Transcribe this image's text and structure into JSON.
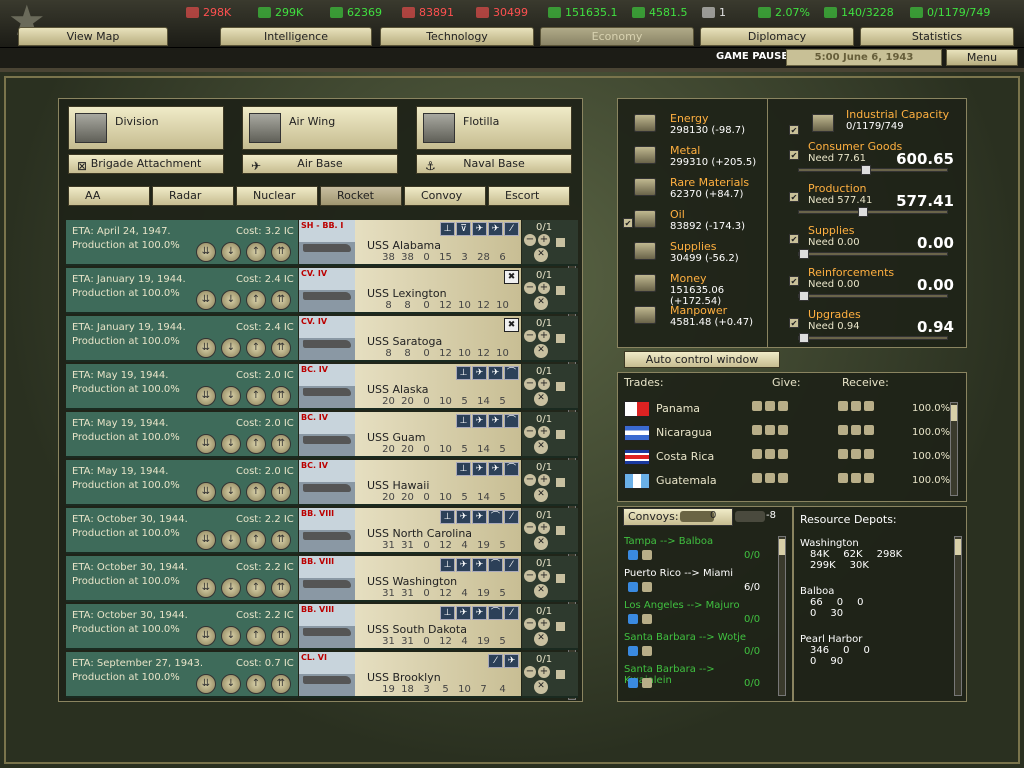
{
  "topbar": {
    "resources": [
      {
        "icon": "energy-icon",
        "value": "298K",
        "color": "#ff5050"
      },
      {
        "icon": "metal-icon",
        "value": "299K",
        "color": "#40e040"
      },
      {
        "icon": "rare-materials-icon",
        "value": "62369",
        "color": "#40e040"
      },
      {
        "icon": "oil-icon",
        "value": "83891",
        "color": "#ff5050"
      },
      {
        "icon": "supplies-icon",
        "value": "30499",
        "color": "#ff5050"
      },
      {
        "icon": "money-icon",
        "value": "151635.1",
        "color": "#40e040"
      },
      {
        "icon": "manpower-icon",
        "value": "4581.5",
        "color": "#40e040"
      },
      {
        "icon": "nuclear-icon",
        "value": "1",
        "color": "#e0e0e0"
      },
      {
        "icon": "dissent-icon",
        "value": "2.07%",
        "color": "#40e040"
      },
      {
        "icon": "transport-icon",
        "value": "140/3228",
        "color": "#40e040"
      },
      {
        "icon": "ic-icon",
        "value": "0/1179/749",
        "color": "#40e040"
      }
    ],
    "tabs": [
      "View Map",
      "Intelligence",
      "Technology",
      "Economy",
      "Diplomacy",
      "Statistics"
    ],
    "status": "GAME PAUSED",
    "date": "5:00 June 6, 1943",
    "menu": "Menu"
  },
  "build": {
    "types": [
      {
        "label": "Division",
        "icon": "division-icon"
      },
      {
        "label": "Air Wing",
        "icon": "air-wing-icon"
      },
      {
        "label": "Flotilla",
        "icon": "flotilla-icon"
      }
    ],
    "attachments": [
      {
        "label": "Brigade Attachment",
        "icon": "brigade-icon",
        "sym": "⊠"
      },
      {
        "label": "Air Base",
        "icon": "air-base-icon",
        "sym": "✈"
      },
      {
        "label": "Naval Base",
        "icon": "naval-base-icon",
        "sym": "⚓"
      }
    ],
    "filters": [
      {
        "label": "AA",
        "on": false
      },
      {
        "label": "Radar",
        "on": false
      },
      {
        "label": "Nuclear",
        "on": false
      },
      {
        "label": "Rocket",
        "on": true
      },
      {
        "label": "Convoy",
        "on": false
      },
      {
        "label": "Escort",
        "on": false
      }
    ]
  },
  "queue": [
    {
      "eta": "ETA: April 24, 1947.",
      "prod": "Production at 100.0%",
      "cost": "Cost: 3.2 IC",
      "cls": "SH - BB. I",
      "name": "USS Alabama",
      "stats": [
        "38",
        "38",
        "0",
        "15",
        "3",
        "28",
        "6"
      ],
      "roles": [
        "⊥",
        "⊽",
        "✈",
        "✈",
        "⁄"
      ],
      "frac": "0/1"
    },
    {
      "eta": "ETA: January 19, 1944.",
      "prod": "Production at 100.0%",
      "cost": "Cost: 2.4 IC",
      "cls": "CV. IV",
      "name": "USS Lexington",
      "stats": [
        "8",
        "8",
        "0",
        "12",
        "10",
        "12",
        "10"
      ],
      "roles": [
        "x"
      ],
      "frac": "0/1"
    },
    {
      "eta": "ETA: January 19, 1944.",
      "prod": "Production at 100.0%",
      "cost": "Cost: 2.4 IC",
      "cls": "CV. IV",
      "name": "USS Saratoga",
      "stats": [
        "8",
        "8",
        "0",
        "12",
        "10",
        "12",
        "10"
      ],
      "roles": [
        "x"
      ],
      "frac": "0/1"
    },
    {
      "eta": "ETA: May 19, 1944.",
      "prod": "Production at 100.0%",
      "cost": "Cost: 2.0 IC",
      "cls": "BC. IV",
      "name": "USS Alaska",
      "stats": [
        "20",
        "20",
        "0",
        "10",
        "5",
        "14",
        "5"
      ],
      "roles": [
        "⊥",
        "✈",
        "✈",
        "⌒"
      ],
      "frac": "0/1"
    },
    {
      "eta": "ETA: May 19, 1944.",
      "prod": "Production at 100.0%",
      "cost": "Cost: 2.0 IC",
      "cls": "BC. IV",
      "name": "USS Guam",
      "stats": [
        "20",
        "20",
        "0",
        "10",
        "5",
        "14",
        "5"
      ],
      "roles": [
        "⊥",
        "✈",
        "✈",
        "⌒"
      ],
      "frac": "0/1"
    },
    {
      "eta": "ETA: May 19, 1944.",
      "prod": "Production at 100.0%",
      "cost": "Cost: 2.0 IC",
      "cls": "BC. IV",
      "name": "USS Hawaii",
      "stats": [
        "20",
        "20",
        "0",
        "10",
        "5",
        "14",
        "5"
      ],
      "roles": [
        "⊥",
        "✈",
        "✈",
        "⌒"
      ],
      "frac": "0/1"
    },
    {
      "eta": "ETA: October 30, 1944.",
      "prod": "Production at 100.0%",
      "cost": "Cost: 2.2 IC",
      "cls": "BB. VIII",
      "name": "USS North Carolina",
      "stats": [
        "31",
        "31",
        "0",
        "12",
        "4",
        "19",
        "5"
      ],
      "roles": [
        "⊥",
        "✈",
        "✈",
        "⌒",
        "⁄"
      ],
      "frac": "0/1"
    },
    {
      "eta": "ETA: October 30, 1944.",
      "prod": "Production at 100.0%",
      "cost": "Cost: 2.2 IC",
      "cls": "BB. VIII",
      "name": "USS Washington",
      "stats": [
        "31",
        "31",
        "0",
        "12",
        "4",
        "19",
        "5"
      ],
      "roles": [
        "⊥",
        "✈",
        "✈",
        "⌒",
        "⁄"
      ],
      "frac": "0/1"
    },
    {
      "eta": "ETA: October 30, 1944.",
      "prod": "Production at 100.0%",
      "cost": "Cost: 2.2 IC",
      "cls": "BB. VIII",
      "name": "USS South Dakota",
      "stats": [
        "31",
        "31",
        "0",
        "12",
        "4",
        "19",
        "5"
      ],
      "roles": [
        "⊥",
        "✈",
        "✈",
        "⌒",
        "⁄"
      ],
      "frac": "0/1"
    },
    {
      "eta": "ETA: September 27, 1943.",
      "prod": "Production at 100.0%",
      "cost": "Cost: 0.7 IC",
      "cls": "CL. VI",
      "name": "USS Brooklyn",
      "stats": [
        "19",
        "18",
        "3",
        "5",
        "10",
        "7",
        "4"
      ],
      "roles": [
        "⁄",
        "✈"
      ],
      "frac": "0/1"
    }
  ],
  "resources": [
    {
      "name": "Energy",
      "value": "298130 (-98.7)",
      "icon": "energy-icon"
    },
    {
      "name": "Metal",
      "value": "299310 (+205.5)",
      "icon": "metal-icon"
    },
    {
      "name": "Rare Materials",
      "value": "62370 (+84.7)",
      "icon": "rare-materials-icon"
    },
    {
      "name": "Oil",
      "value": "83892 (-174.3)",
      "icon": "oil-icon"
    },
    {
      "name": "Supplies",
      "value": "30499 (-56.2)",
      "icon": "supplies-icon"
    },
    {
      "name": "Money",
      "value": "151635.06 (+172.54)",
      "icon": "money-icon"
    },
    {
      "name": "Manpower",
      "value": "4581.48 (+0.47)",
      "icon": "manpower-icon"
    }
  ],
  "ic": {
    "name": "Industrial Capacity",
    "value": "0/1179/749"
  },
  "sliders": [
    {
      "name": "Consumer Goods",
      "need": "Need 77.61",
      "value": "600.65",
      "pos": 0.44
    },
    {
      "name": "Production",
      "need": "Need 577.41",
      "value": "577.41",
      "pos": 0.42
    },
    {
      "name": "Supplies",
      "need": "Need 0.00",
      "value": "0.00",
      "pos": 0.0
    },
    {
      "name": "Reinforcements",
      "need": "Need 0.00",
      "value": "0.00",
      "pos": 0.0
    },
    {
      "name": "Upgrades",
      "need": "Need 0.94",
      "value": "0.94",
      "pos": 0.0
    }
  ],
  "auto_control": "Auto control window",
  "trades": {
    "headers": {
      "trades": "Trades:",
      "give": "Give:",
      "receive": "Receive:"
    },
    "rows": [
      {
        "country": "Panama",
        "pct": "100.0%",
        "flag": "panama-flag"
      },
      {
        "country": "Nicaragua",
        "pct": "100.0%",
        "flag": "nicaragua-flag"
      },
      {
        "country": "Costa Rica",
        "pct": "100.0%",
        "flag": "costa-rica-flag"
      },
      {
        "country": "Guatemala",
        "pct": "100.0%",
        "flag": "guatemala-flag"
      }
    ]
  },
  "convoys": {
    "label": "Convoys:",
    "transports": "0",
    "escorts": "-8",
    "routes": [
      {
        "route": "Tampa --> Balboa",
        "q": "0/0",
        "green": true
      },
      {
        "route": "Puerto Rico --> Miami",
        "q": "6/0",
        "green": false
      },
      {
        "route": "Los Angeles --> Majuro",
        "q": "0/0",
        "green": true
      },
      {
        "route": "Santa Barbara --> Wotje",
        "q": "0/0",
        "green": true
      },
      {
        "route": "Santa Barbara --> Kwajalein",
        "q": "0/0",
        "green": true
      }
    ]
  },
  "depots": {
    "label": "Resource Depots:",
    "items": [
      {
        "name": "Washington",
        "line1": [
          "84K",
          "62K",
          "298K"
        ],
        "line2": [
          "299K",
          "30K"
        ]
      },
      {
        "name": "Balboa",
        "line1": [
          "66",
          "0",
          "0"
        ],
        "line2": [
          "0",
          "30"
        ]
      },
      {
        "name": "Pearl Harbor",
        "line1": [
          "346",
          "0",
          "0"
        ],
        "line2": [
          "0",
          "90"
        ]
      }
    ]
  }
}
